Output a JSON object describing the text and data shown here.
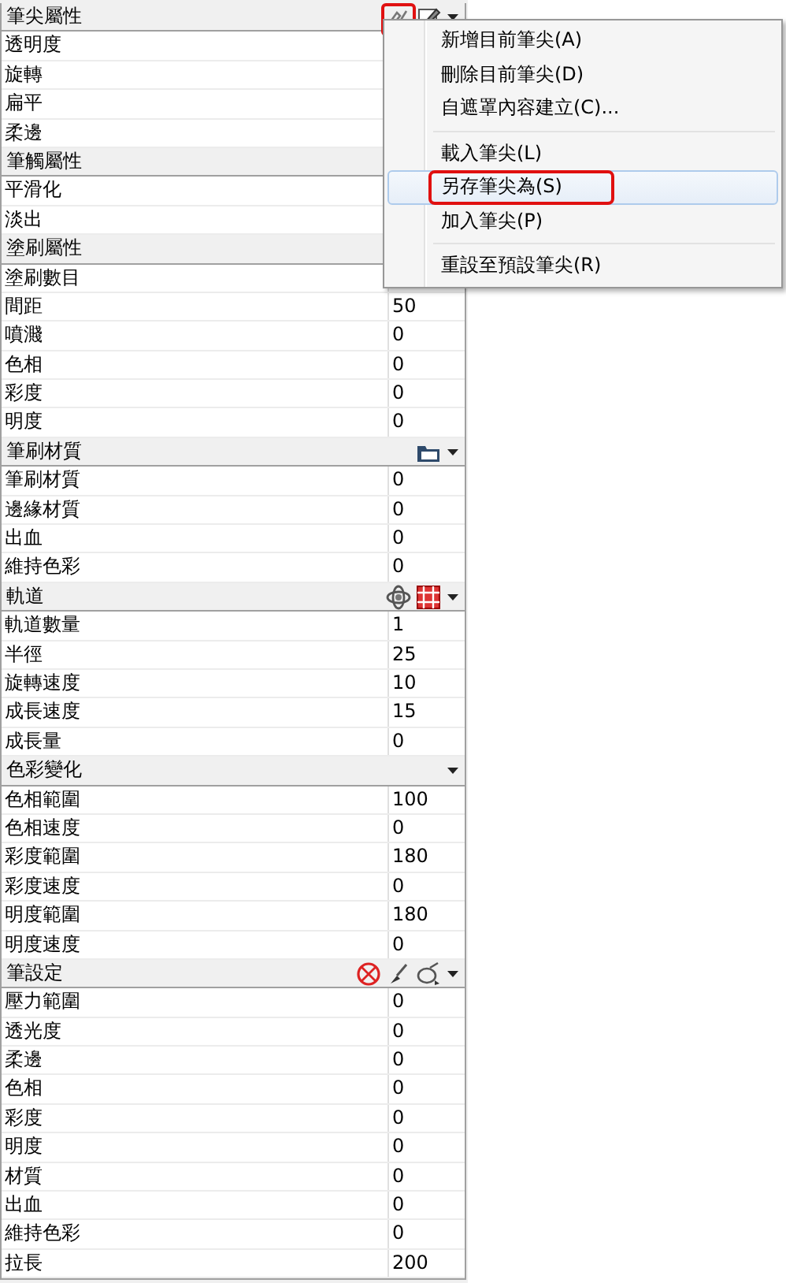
{
  "sections": [
    {
      "title": "筆尖屬性",
      "icons": [
        {
          "kind": "brush-tip",
          "annotated": true
        },
        {
          "kind": "edit"
        }
      ],
      "dropdown": true,
      "rows": [
        {
          "name": "透明度"
        },
        {
          "name": "旋轉"
        },
        {
          "name": "扁平"
        },
        {
          "name": "柔邊"
        }
      ]
    },
    {
      "title": "筆觸屬性",
      "rows": [
        {
          "name": "平滑化"
        },
        {
          "name": "淡出"
        }
      ]
    },
    {
      "title": "塗刷屬性",
      "rows": [
        {
          "name": "塗刷數目"
        },
        {
          "name": "間距",
          "value": "50"
        },
        {
          "name": "噴濺",
          "value": "0"
        },
        {
          "name": "色相",
          "value": "0"
        },
        {
          "name": "彩度",
          "value": "0"
        },
        {
          "name": "明度",
          "value": "0"
        }
      ]
    },
    {
      "title": "筆刷材質",
      "icons": [
        {
          "kind": "folder"
        }
      ],
      "dropdown": true,
      "rows": [
        {
          "name": "筆刷材質",
          "value": "0"
        },
        {
          "name": "邊緣材質",
          "value": "0"
        },
        {
          "name": "出血",
          "value": "0"
        },
        {
          "name": "維持色彩",
          "value": "0"
        }
      ]
    },
    {
      "title": "軌道",
      "icons": [
        {
          "kind": "orbit"
        },
        {
          "kind": "grid"
        }
      ],
      "dropdown": true,
      "rows": [
        {
          "name": "軌道數量",
          "value": "1"
        },
        {
          "name": "半徑",
          "value": "25"
        },
        {
          "name": "旋轉速度",
          "value": "10"
        },
        {
          "name": "成長速度",
          "value": "15"
        },
        {
          "name": "成長量",
          "value": "0"
        }
      ]
    },
    {
      "title": "色彩變化",
      "dropdown": true,
      "rows": [
        {
          "name": "色相範圍",
          "value": "100"
        },
        {
          "name": "色相速度",
          "value": "0"
        },
        {
          "name": "彩度範圍",
          "value": "180"
        },
        {
          "name": "彩度速度",
          "value": "0"
        },
        {
          "name": "明度範圍",
          "value": "180"
        },
        {
          "name": "明度速度",
          "value": "0"
        }
      ]
    },
    {
      "title": "筆設定",
      "icons": [
        {
          "kind": "no-sign"
        },
        {
          "kind": "brush"
        },
        {
          "kind": "pen"
        }
      ],
      "dropdown": true,
      "rows": [
        {
          "name": "壓力範圍",
          "value": "0"
        },
        {
          "name": "透光度",
          "value": "0"
        },
        {
          "name": "柔邊",
          "value": "0"
        },
        {
          "name": "色相",
          "value": "0"
        },
        {
          "name": "彩度",
          "value": "0"
        },
        {
          "name": "明度",
          "value": "0"
        },
        {
          "name": "材質",
          "value": "0"
        },
        {
          "name": "出血",
          "value": "0"
        },
        {
          "name": "維持色彩",
          "value": "0"
        },
        {
          "name": "拉長",
          "value": "200"
        }
      ]
    }
  ],
  "menu": {
    "items": [
      {
        "kind": "item",
        "label": "新增目前筆尖(A)",
        "selected": false
      },
      {
        "kind": "item",
        "label": "刪除目前筆尖(D)",
        "selected": false
      },
      {
        "kind": "item",
        "label": "自遮罩內容建立(C)...",
        "selected": false
      },
      {
        "kind": "separator"
      },
      {
        "kind": "item",
        "label": "載入筆尖(L)",
        "selected": false
      },
      {
        "kind": "item",
        "label": "另存筆尖為(S)",
        "selected": true,
        "annotated": true
      },
      {
        "kind": "item",
        "label": "加入筆尖(P)",
        "selected": false
      },
      {
        "kind": "separator"
      },
      {
        "kind": "item",
        "label": "重設至預設筆尖(R)",
        "selected": false
      }
    ]
  }
}
